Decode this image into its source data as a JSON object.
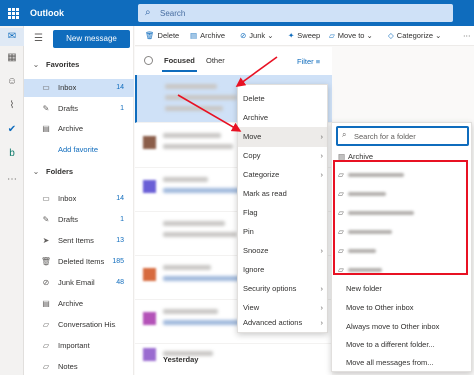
{
  "app": {
    "title": "Outlook",
    "search_placeholder": "Search"
  },
  "nav": {
    "new_message": "New message",
    "favorites_header": "Favorites",
    "favorites": [
      {
        "label": "Inbox",
        "count": "14"
      },
      {
        "label": "Drafts",
        "count": "1"
      },
      {
        "label": "Archive",
        "count": ""
      }
    ],
    "add_favorite": "Add favorite",
    "folders_header": "Folders",
    "folders": [
      {
        "label": "Inbox",
        "count": "14"
      },
      {
        "label": "Drafts",
        "count": "1"
      },
      {
        "label": "Sent Items",
        "count": "13"
      },
      {
        "label": "Deleted Items",
        "count": "185"
      },
      {
        "label": "Junk Email",
        "count": "48"
      },
      {
        "label": "Archive",
        "count": ""
      },
      {
        "label": "Conversation His...",
        "count": ""
      },
      {
        "label": "Important",
        "count": ""
      },
      {
        "label": "Notes",
        "count": ""
      }
    ]
  },
  "toolbar": {
    "delete": "Delete",
    "archive": "Archive",
    "junk": "Junk",
    "sweep": "Sweep",
    "move_to": "Move to",
    "categorize": "Categorize"
  },
  "maillist": {
    "tab_focused": "Focused",
    "tab_other": "Other",
    "filter": "Filter",
    "group_yesterday": "Yesterday"
  },
  "context_menu": [
    {
      "label": "Delete"
    },
    {
      "label": "Archive"
    },
    {
      "label": "Move"
    },
    {
      "label": "Copy"
    },
    {
      "label": "Categorize"
    },
    {
      "label": "Mark as read"
    },
    {
      "label": "Flag"
    },
    {
      "label": "Pin"
    },
    {
      "label": "Snooze"
    },
    {
      "label": "Ignore"
    },
    {
      "label": "Security options"
    },
    {
      "label": "View"
    },
    {
      "label": "Advanced actions"
    }
  ],
  "move_submenu": {
    "search_placeholder": "Search for a folder",
    "archive": "Archive",
    "new_folder": "New folder",
    "move_to_other_inbox": "Move to Other inbox",
    "always_move_to_other_inbox": "Always move to Other inbox",
    "move_to_different_folder": "Move to a different folder...",
    "move_all_messages_from": "Move all messages from..."
  },
  "colors": {
    "accent": "#0f6cbd",
    "highlight": "#e81123"
  }
}
